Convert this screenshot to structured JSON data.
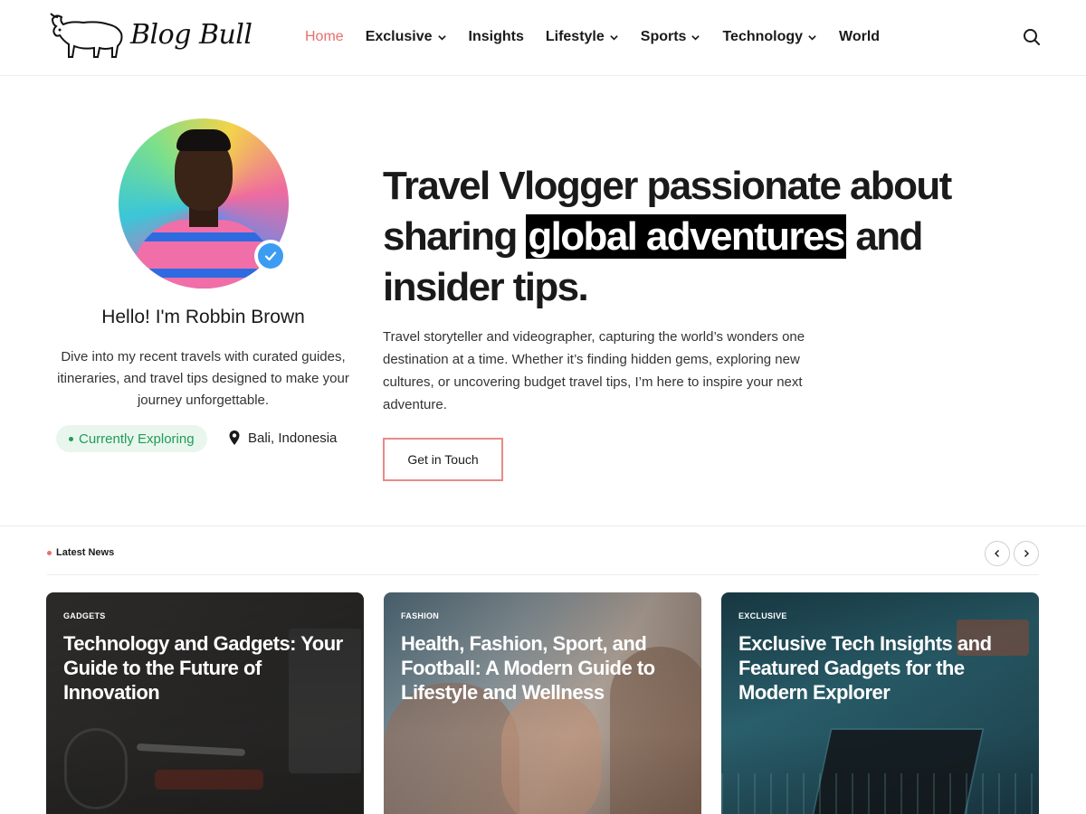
{
  "header": {
    "logo_text": "Blog Bull",
    "nav": [
      {
        "label": "Home",
        "active": true,
        "dropdown": false
      },
      {
        "label": "Exclusive",
        "active": false,
        "dropdown": true
      },
      {
        "label": "Insights",
        "active": false,
        "dropdown": false
      },
      {
        "label": "Lifestyle",
        "active": false,
        "dropdown": true
      },
      {
        "label": "Sports",
        "active": false,
        "dropdown": true
      },
      {
        "label": "Technology",
        "active": false,
        "dropdown": true
      },
      {
        "label": "World",
        "active": false,
        "dropdown": false
      }
    ],
    "search_icon": "search-icon"
  },
  "profile": {
    "greeting": "Hello! I'm Robbin Brown",
    "intro": "Dive into my recent travels with curated guides, itineraries, and travel tips designed to make your journey unforgettable.",
    "status": "Currently Exploring",
    "location": "Bali, Indonesia",
    "verified_icon": "verified-badge-icon"
  },
  "hero": {
    "headline_before": "Travel Vlogger passionate about sharing ",
    "headline_highlight": "global adventures",
    "headline_after": " and insider tips.",
    "description": "Travel storyteller and videographer, capturing the world’s wonders one destination at a time. Whether it’s finding hidden gems, exploring new cultures, or uncovering budget travel tips, I’m here to inspire your next adventure.",
    "cta_label": "Get in Touch"
  },
  "latest_news": {
    "title": "Latest News",
    "cards": [
      {
        "category": "GADGETS",
        "title": "Technology and Gadgets: Your Guide to the Future of Innovation"
      },
      {
        "category": "FASHION",
        "title": "Health, Fashion, Sport, and Football: A Modern Guide to Lifestyle and Wellness"
      },
      {
        "category": "EXCLUSIVE",
        "title": "Exclusive Tech Insights and Featured Gadgets for the Modern Explorer"
      }
    ]
  },
  "colors": {
    "accent": "#ea6f6c",
    "status_green": "#1f9d55",
    "status_bg": "#e9f6ee",
    "verified_blue": "#3b9cf2"
  }
}
